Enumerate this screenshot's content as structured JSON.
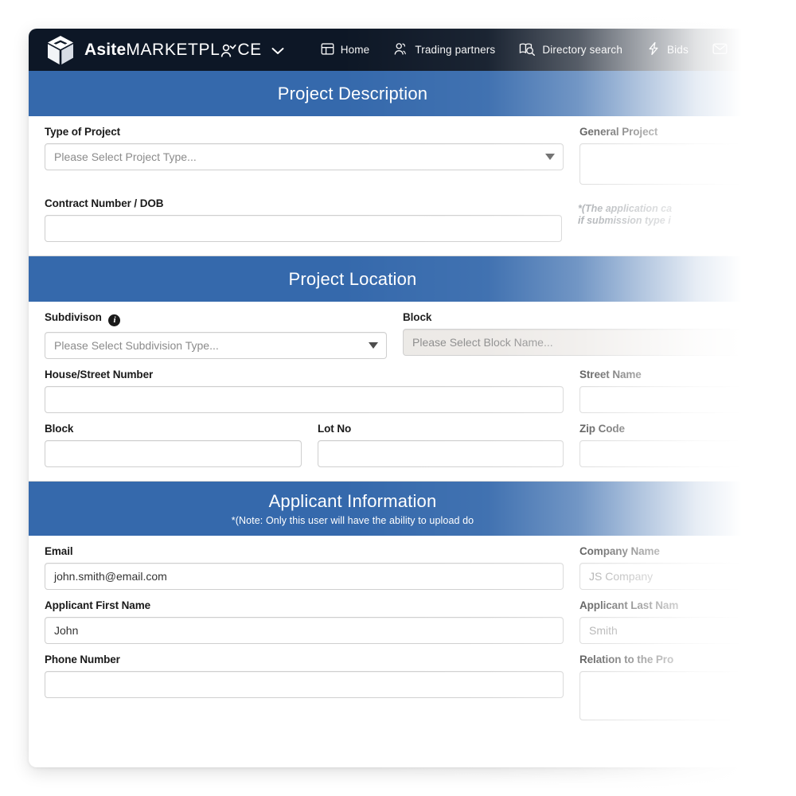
{
  "colors": {
    "navbar_bg": "#0d1726",
    "section_header_bg": "#3569ac",
    "page_bg": "#ffffff",
    "label_text": "#1a1a1a",
    "note_text": "#8e9398",
    "input_border": "#cfcfcf",
    "disabled_input_bg": "#ece9e6"
  },
  "navbar": {
    "brand_strong": "Asite",
    "brand_light_1": "MARKETPL",
    "brand_light_2": "CE",
    "brand_people_icon": "people-icon",
    "brand_caret_icon": "chevron-down-icon",
    "links": [
      {
        "label": "Home",
        "icon": "dashboard-icon"
      },
      {
        "label": "Trading partners",
        "icon": "people-icon"
      },
      {
        "label": "Directory search",
        "icon": "directory-search-icon"
      },
      {
        "label": "Bids",
        "icon": "lightning-icon"
      },
      {
        "label": "",
        "icon": "mail-icon"
      }
    ]
  },
  "sections": [
    {
      "title": "Project Description",
      "note": ""
    },
    {
      "title": "Project Location",
      "note": ""
    },
    {
      "title": "Applicant Information",
      "note": "*(Note: Only this user will have the ability to upload do"
    }
  ],
  "project_description": {
    "type_of_project": {
      "label": "Type of Project",
      "placeholder": "Please Select Project Type...",
      "value": ""
    },
    "general_project": {
      "label": "General Project",
      "placeholder": "",
      "value": ""
    },
    "contract_number": {
      "label": "Contract Number / DOB",
      "placeholder": "",
      "value": ""
    },
    "contract_note_line1": "*(The application ca",
    "contract_note_line2": "if submission type i"
  },
  "project_location": {
    "subdivision": {
      "label": "Subdivison",
      "info_icon": "info-icon",
      "placeholder": "Please Select Subdivision Type...",
      "value": ""
    },
    "block_select": {
      "label": "Block",
      "placeholder": "Please Select Block Name...",
      "value": ""
    },
    "house_street_number": {
      "label": "House/Street Number",
      "placeholder": "",
      "value": ""
    },
    "street_name": {
      "label": "Street Name",
      "placeholder": "",
      "value": ""
    },
    "block": {
      "label": "Block",
      "placeholder": "",
      "value": ""
    },
    "lot_no": {
      "label": "Lot No",
      "placeholder": "",
      "value": ""
    },
    "zip_code": {
      "label": "Zip Code",
      "placeholder": "",
      "value": ""
    }
  },
  "applicant_information": {
    "email": {
      "label": "Email",
      "placeholder": "",
      "value": "john.smith@email.com"
    },
    "company_name": {
      "label": "Company Name",
      "placeholder": "JS Company",
      "value": ""
    },
    "first_name": {
      "label": "Applicant First Name",
      "placeholder": "",
      "value": "John"
    },
    "last_name": {
      "label": "Applicant Last Nam",
      "placeholder": "Smith",
      "value": ""
    },
    "phone_number": {
      "label": "Phone Number",
      "placeholder": "",
      "value": ""
    },
    "relation": {
      "label": "Relation to the Pro",
      "placeholder": "",
      "value": ""
    }
  }
}
